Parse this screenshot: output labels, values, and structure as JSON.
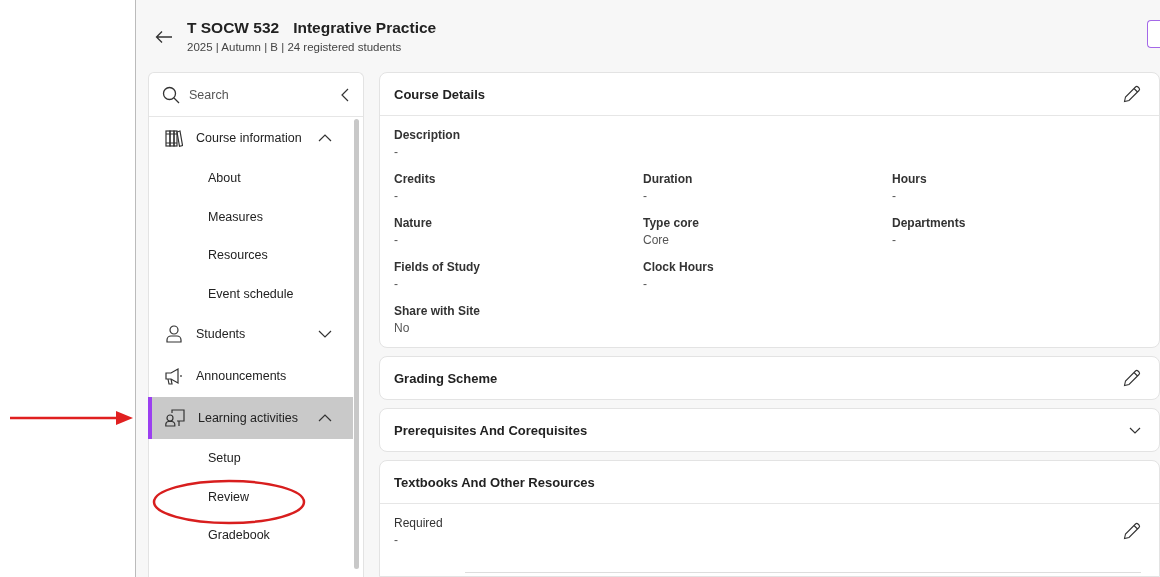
{
  "header": {
    "code": "T SOCW 532",
    "name": "Integrative Practice",
    "subtitle": "2025 | Autumn | B | 24 registered students"
  },
  "sidebar": {
    "search": {
      "placeholder": "Search"
    },
    "items": [
      {
        "label": "Course information",
        "kind": "books",
        "expanded": true,
        "selected": false,
        "children": [
          {
            "label": "About",
            "selected": false
          },
          {
            "label": "Measures",
            "selected": false
          },
          {
            "label": "Resources",
            "selected": false
          },
          {
            "label": "Event schedule",
            "selected": false
          }
        ]
      },
      {
        "label": "Students",
        "kind": "person",
        "expanded": false,
        "selected": false
      },
      {
        "label": "Announcements",
        "kind": "megaphone",
        "selected": false
      },
      {
        "label": "Learning activities",
        "kind": "teacher",
        "expanded": true,
        "selected": true,
        "children": [
          {
            "label": "Setup",
            "selected": false
          },
          {
            "label": "Review",
            "selected": false
          },
          {
            "label": "Gradebook",
            "selected": false
          }
        ]
      }
    ]
  },
  "cards": [
    {
      "kind": "details",
      "title": "Course Details",
      "rows": [
        [
          {
            "label": "Description",
            "value": "-"
          }
        ],
        [
          {
            "label": "Credits",
            "value": "-"
          },
          {
            "label": "Duration",
            "value": "-"
          },
          {
            "label": "Hours",
            "value": "-"
          }
        ],
        [
          {
            "label": "Nature",
            "value": "-"
          },
          {
            "label": "Type core",
            "value": "Core"
          },
          {
            "label": "Departments",
            "value": "-"
          }
        ],
        [
          {
            "label": "Fields of Study",
            "value": "-"
          },
          {
            "label": "Clock Hours",
            "value": "-"
          }
        ],
        [
          {
            "label": "Share with Site",
            "value": "No"
          }
        ]
      ]
    },
    {
      "kind": "editable",
      "title": "Grading Scheme"
    },
    {
      "kind": "collapsible",
      "title": "Prerequisites And Corequisites",
      "expanded": false
    },
    {
      "kind": "sections",
      "title": "Textbooks And Other Resources",
      "sections": [
        {
          "label": "Required",
          "value": "-"
        }
      ]
    }
  ]
}
